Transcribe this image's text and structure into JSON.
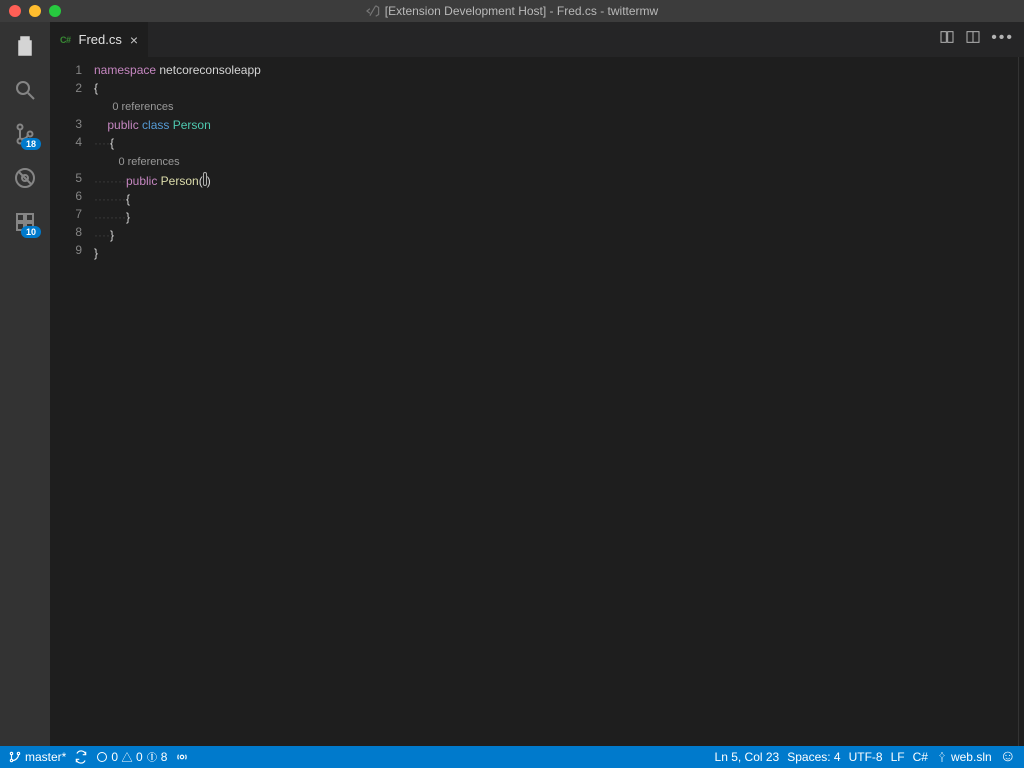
{
  "title": "[Extension Development Host] - Fred.cs - twittermw",
  "tab": {
    "langbadge": "C#",
    "name": "Fred.cs"
  },
  "activitybar": {
    "scm_badge": "18",
    "ext_badge": "10"
  },
  "gutter": [
    "1",
    "2",
    "",
    "3",
    "4",
    "",
    "5",
    "6",
    "7",
    "8",
    "9"
  ],
  "code": {
    "l1a": "namespace",
    "l1b": " netcoreconsoleapp",
    "l2": "{",
    "cl1": "      0 references",
    "l3a": "    ",
    "l3b": "public",
    "l3c": " class",
    "l3d": " Person",
    "l4": "    {",
    "cl2": "        0 references",
    "l5a": "        ",
    "l5b": "public",
    "l5c": " Person",
    "l5d": "(",
    "l5e": ")",
    "l6": "        {",
    "l7": "        }",
    "l8": "    }",
    "l9": "}"
  },
  "status": {
    "branch": "master*",
    "err": "0",
    "warn": "0",
    "info": "8",
    "pos": "Ln 5, Col 23",
    "spaces": "Spaces: 4",
    "enc": "UTF-8",
    "eol": "LF",
    "lang": "C#",
    "proj": "web.sln"
  }
}
